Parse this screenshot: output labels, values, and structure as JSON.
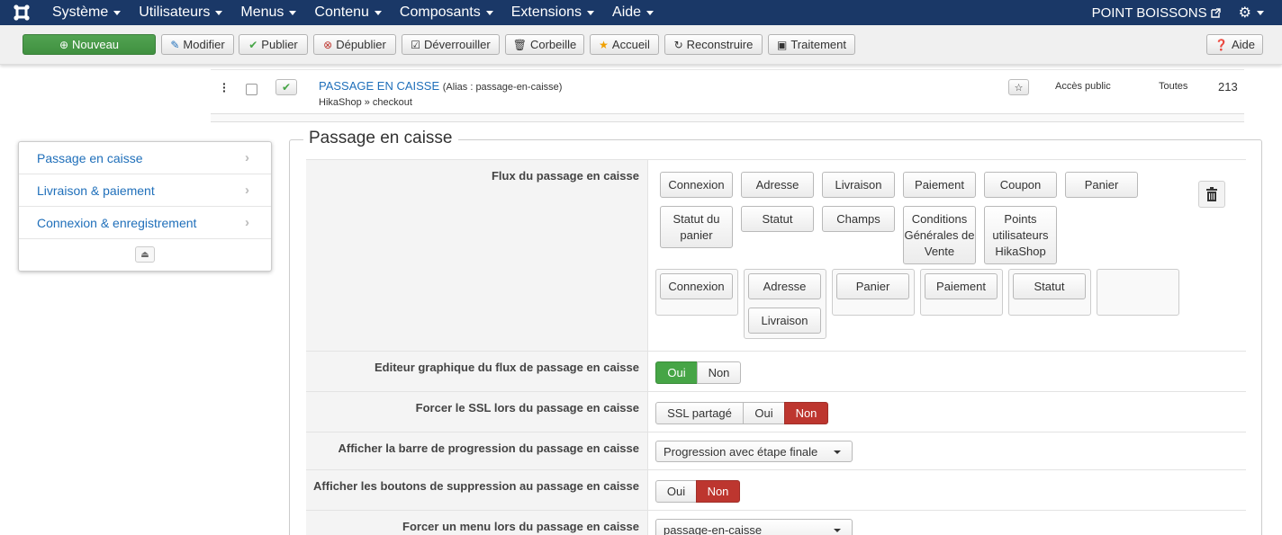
{
  "topnav": {
    "menus": [
      "Système",
      "Utilisateurs",
      "Menus",
      "Contenu",
      "Composants",
      "Extensions",
      "Aide"
    ],
    "site_name": "POINT BOISSONS"
  },
  "toolbar": {
    "new": "Nouveau",
    "edit": "Modifier",
    "publish": "Publier",
    "unpublish": "Dépublier",
    "checkin": "Déverrouiller",
    "trash": "Corbeille",
    "home": "Accueil",
    "rebuild": "Reconstruire",
    "batch": "Traitement",
    "help": "Aide"
  },
  "table_row": {
    "title": "PASSAGE EN CAISSE",
    "alias": "(Alias : passage-en-caisse)",
    "subtitle": "HikaShop » checkout",
    "access": "Accès public",
    "language": "Toutes",
    "id": "213"
  },
  "sidemenu": {
    "items": [
      "Passage en caisse",
      "Livraison & paiement",
      "Connexion & enregistrement"
    ]
  },
  "section": {
    "legend": "Passage en caisse"
  },
  "settings": {
    "flow": {
      "label": "Flux du passage en caisse",
      "available": [
        "Connexion",
        "Adresse",
        "Livraison",
        "Paiement",
        "Coupon",
        "Panier",
        "Statut du panier",
        "Statut",
        "Champs",
        "Conditions Générales de Vente",
        "Points utilisateurs HikaShop"
      ],
      "steps": [
        "Connexion",
        "Adresse",
        "Livraison",
        "Panier",
        "Paiement",
        "Statut"
      ]
    },
    "editor": {
      "label": "Editeur graphique du flux de passage en caisse",
      "options": [
        "Oui",
        "Non"
      ],
      "selected": "Oui"
    },
    "ssl": {
      "label": "Forcer le SSL lors du passage en caisse",
      "options": [
        "SSL partagé",
        "Oui",
        "Non"
      ],
      "selected": "Non"
    },
    "progress": {
      "label": "Afficher la barre de progression du passage en caisse",
      "value": "Progression avec étape finale"
    },
    "delete_buttons": {
      "label": "Afficher les boutons de suppression au passage en caisse",
      "options": [
        "Oui",
        "Non"
      ],
      "selected": "Non"
    },
    "force_menu": {
      "label": "Forcer un menu lors du passage en caisse",
      "value": "passage-en-caisse"
    }
  },
  "colors": {
    "nav_bg": "#1a3867",
    "green": "#46a546",
    "red": "#bd362f",
    "link": "#1f6fba"
  }
}
